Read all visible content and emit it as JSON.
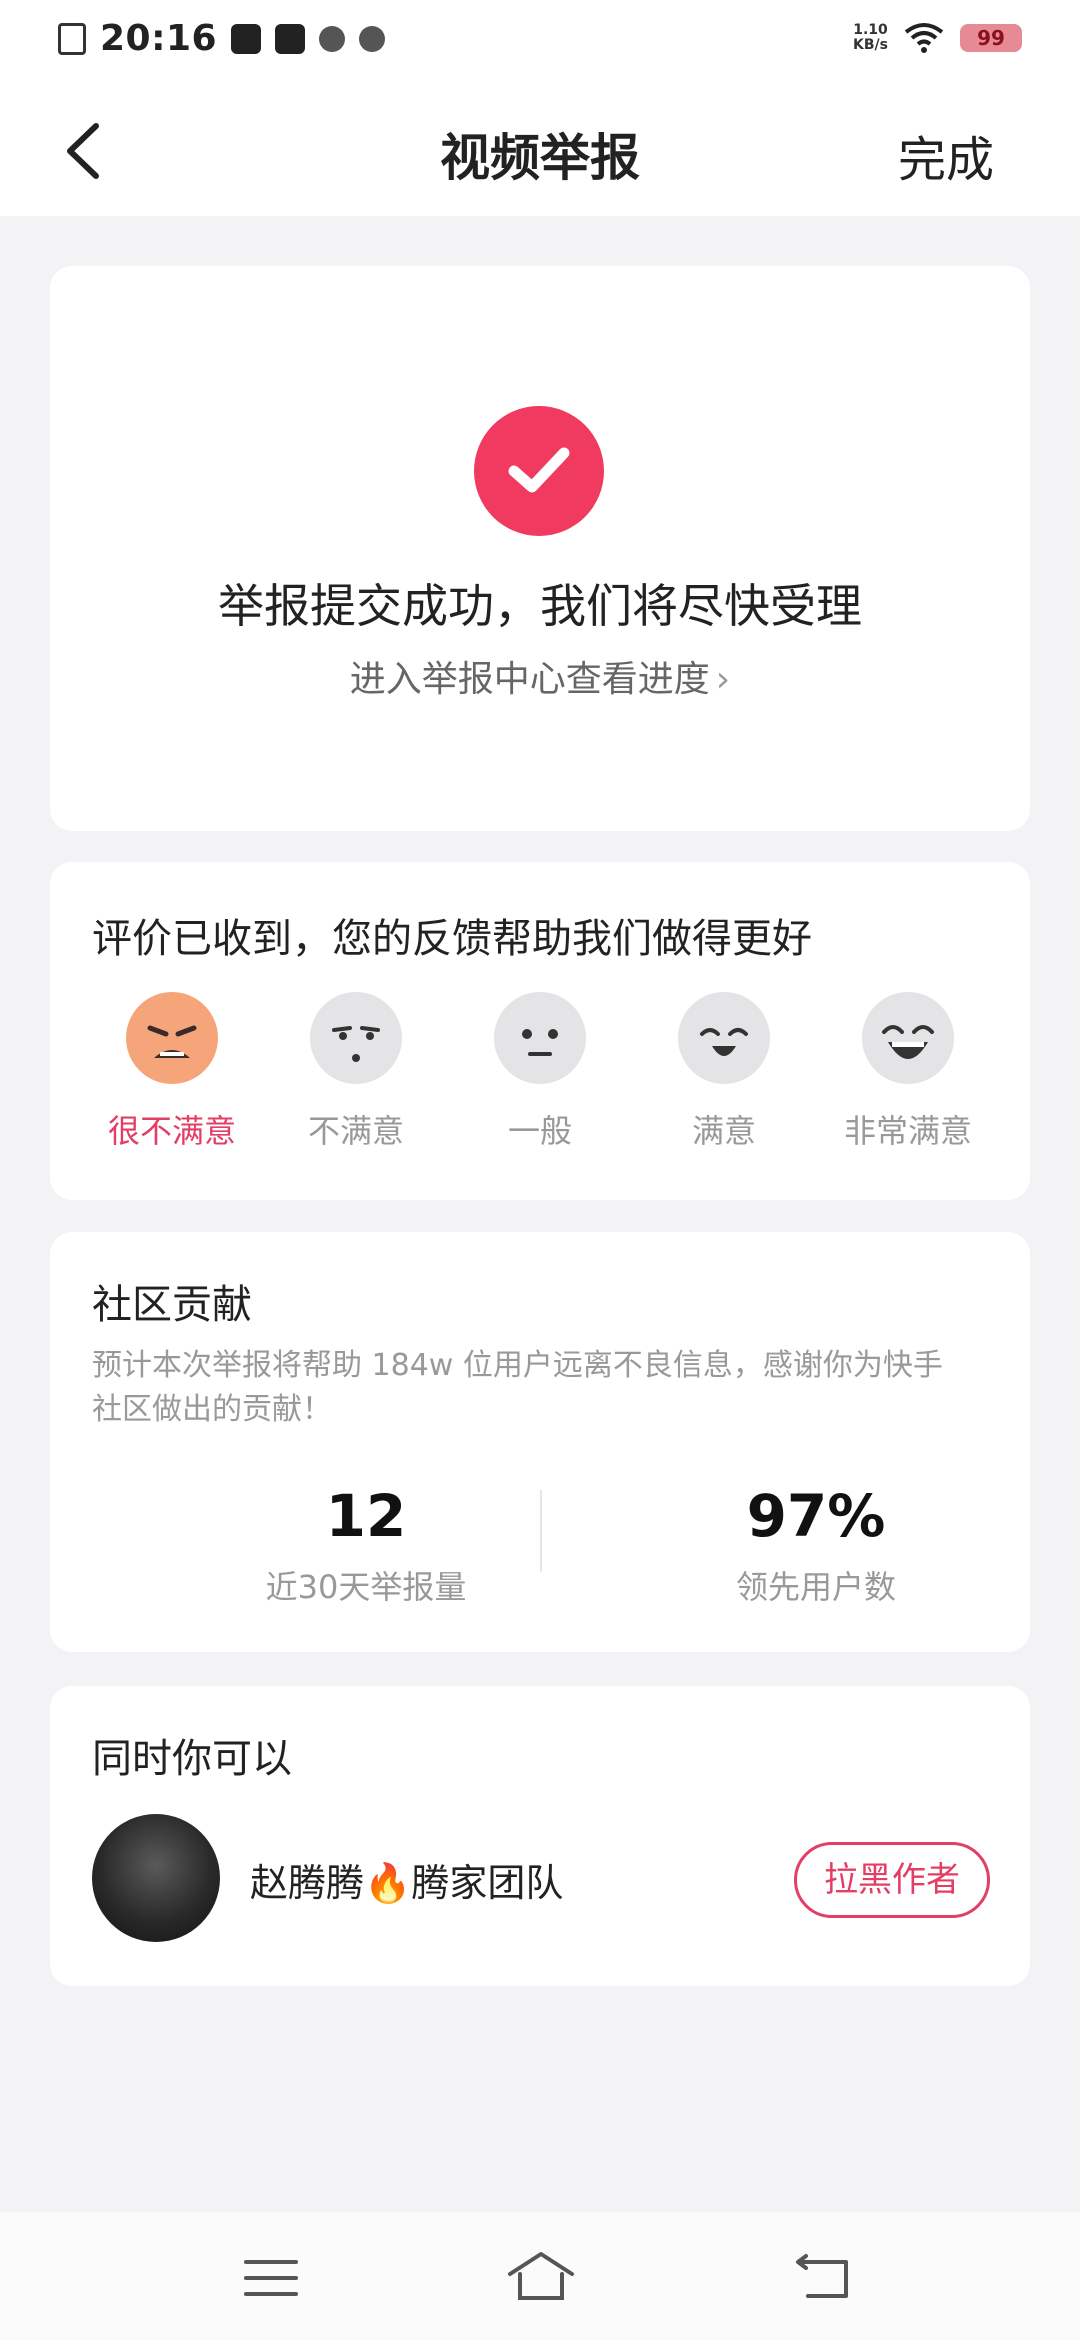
{
  "status_bar": {
    "time": "20:16",
    "network_speed_value": "1.10",
    "network_speed_unit": "KB/s",
    "battery": "99",
    "icons": [
      "sim-error-icon",
      "app-notification-icon",
      "tiktok-icon",
      "avatar-notification-icon",
      "link-icon",
      "wifi-icon",
      "battery-icon"
    ]
  },
  "header": {
    "back_icon": "chevron-left-icon",
    "title": "视频举报",
    "done_label": "完成"
  },
  "success": {
    "icon": "check-icon",
    "accent_color": "#f03a5f",
    "title": "举报提交成功，我们将尽快受理",
    "progress_link": "进入举报中心查看进度"
  },
  "rating": {
    "heading": "评价已收到，您的反馈帮助我们做得更好",
    "selected_index": 0,
    "options": [
      {
        "label": "很不满意",
        "icon": "angry-face-icon"
      },
      {
        "label": "不满意",
        "icon": "unimpressed-face-icon"
      },
      {
        "label": "一般",
        "icon": "neutral-face-icon"
      },
      {
        "label": "满意",
        "icon": "smiling-face-icon"
      },
      {
        "label": "非常满意",
        "icon": "laughing-face-icon"
      }
    ]
  },
  "contribution": {
    "heading": "社区贡献",
    "description": "预计本次举报将帮助 184w 位用户远离不良信息，感谢你为快手社区做出的贡献！",
    "stats": [
      {
        "value": "12",
        "label": "近30天举报量"
      },
      {
        "value": "97%",
        "label": "领先用户数"
      }
    ]
  },
  "actions": {
    "heading": "同时你可以",
    "author_name": "赵腾腾🔥腾家团队",
    "block_label": "拉黑作者",
    "block_color": "#e23e66"
  },
  "nav": {
    "icons": [
      "menu-icon",
      "home-icon",
      "back-icon"
    ]
  }
}
